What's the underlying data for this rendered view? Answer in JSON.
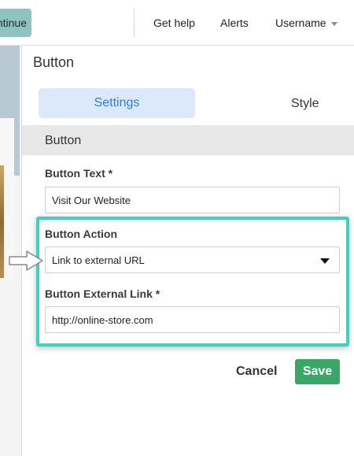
{
  "topbar": {
    "continue_label": "Continue",
    "help_label": "Get help",
    "alerts_label": "Alerts",
    "username_label": "Username"
  },
  "panel": {
    "title": "Button",
    "tabs": [
      {
        "label": "Settings",
        "active": true
      },
      {
        "label": "Style",
        "active": false
      }
    ],
    "section_title": "Button",
    "fields": {
      "button_text": {
        "label": "Button Text *",
        "value": "Visit Our Website"
      },
      "button_action": {
        "label": "Button Action",
        "value": "Link to external URL"
      },
      "external_link": {
        "label": "Button External Link *",
        "value": "http://online-store.com"
      }
    },
    "cancel_label": "Cancel",
    "save_label": "Save"
  },
  "colors": {
    "accent_blue": "#2d7de0",
    "highlight_teal": "#3fd1c1",
    "save_green": "#3aa769"
  },
  "icons": {
    "dropdown": "caret-down-icon",
    "pointer": "arrow-right-icon"
  }
}
